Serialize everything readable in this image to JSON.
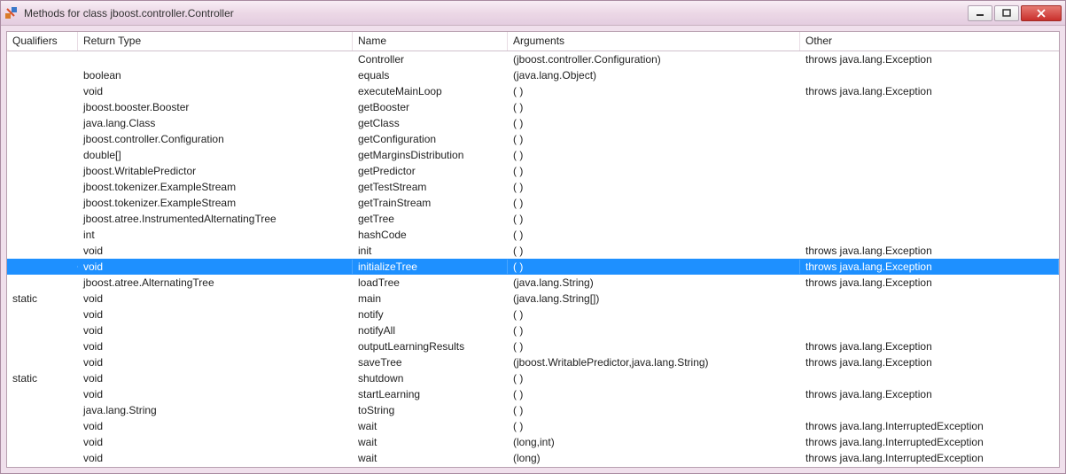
{
  "window": {
    "title": "Methods for class jboost.controller.Controller"
  },
  "columns": {
    "qualifiers": "Qualifiers",
    "returnType": "Return Type",
    "name": "Name",
    "arguments": "Arguments",
    "other": "Other"
  },
  "selected_index": 14,
  "methods": [
    {
      "q": "",
      "r": "",
      "n": "Controller",
      "a": "(jboost.controller.Configuration)",
      "o": "throws java.lang.Exception"
    },
    {
      "q": "",
      "r": "boolean",
      "n": "equals",
      "a": "(java.lang.Object)",
      "o": ""
    },
    {
      "q": "",
      "r": "void",
      "n": "executeMainLoop",
      "a": "( )",
      "o": "throws java.lang.Exception"
    },
    {
      "q": "",
      "r": "jboost.booster.Booster",
      "n": "getBooster",
      "a": "( )",
      "o": ""
    },
    {
      "q": "",
      "r": "java.lang.Class",
      "n": "getClass",
      "a": "( )",
      "o": ""
    },
    {
      "q": "",
      "r": "jboost.controller.Configuration",
      "n": "getConfiguration",
      "a": "( )",
      "o": ""
    },
    {
      "q": "",
      "r": "double[]",
      "n": "getMarginsDistribution",
      "a": "( )",
      "o": ""
    },
    {
      "q": "",
      "r": "jboost.WritablePredictor",
      "n": "getPredictor",
      "a": "( )",
      "o": ""
    },
    {
      "q": "",
      "r": "jboost.tokenizer.ExampleStream",
      "n": "getTestStream",
      "a": "( )",
      "o": ""
    },
    {
      "q": "",
      "r": "jboost.tokenizer.ExampleStream",
      "n": "getTrainStream",
      "a": "( )",
      "o": ""
    },
    {
      "q": "",
      "r": "jboost.atree.InstrumentedAlternatingTree",
      "n": "getTree",
      "a": "( )",
      "o": ""
    },
    {
      "q": "",
      "r": "int",
      "n": "hashCode",
      "a": "( )",
      "o": ""
    },
    {
      "q": "",
      "r": "void",
      "n": "init",
      "a": "( )",
      "o": "throws java.lang.Exception"
    },
    {
      "q": "",
      "r": "void",
      "n": "initializeTree",
      "a": "( )",
      "o": "throws java.lang.Exception"
    },
    {
      "q": "",
      "r": "jboost.atree.AlternatingTree",
      "n": "loadTree",
      "a": "(java.lang.String)",
      "o": "throws java.lang.Exception"
    },
    {
      "q": "static",
      "r": "void",
      "n": "main",
      "a": "(java.lang.String[])",
      "o": ""
    },
    {
      "q": "",
      "r": "void",
      "n": "notify",
      "a": "( )",
      "o": ""
    },
    {
      "q": "",
      "r": "void",
      "n": "notifyAll",
      "a": "( )",
      "o": ""
    },
    {
      "q": "",
      "r": "void",
      "n": "outputLearningResults",
      "a": "( )",
      "o": "throws java.lang.Exception"
    },
    {
      "q": "",
      "r": "void",
      "n": "saveTree",
      "a": "(jboost.WritablePredictor,java.lang.String)",
      "o": "throws java.lang.Exception"
    },
    {
      "q": "static",
      "r": "void",
      "n": "shutdown",
      "a": "( )",
      "o": ""
    },
    {
      "q": "",
      "r": "void",
      "n": "startLearning",
      "a": "( )",
      "o": "throws java.lang.Exception"
    },
    {
      "q": "",
      "r": "java.lang.String",
      "n": "toString",
      "a": "( )",
      "o": ""
    },
    {
      "q": "",
      "r": "void",
      "n": "wait",
      "a": "( )",
      "o": "throws java.lang.InterruptedException"
    },
    {
      "q": "",
      "r": "void",
      "n": "wait",
      "a": "(long,int)",
      "o": "throws java.lang.InterruptedException"
    },
    {
      "q": "",
      "r": "void",
      "n": "wait",
      "a": "(long)",
      "o": "throws java.lang.InterruptedException"
    }
  ]
}
